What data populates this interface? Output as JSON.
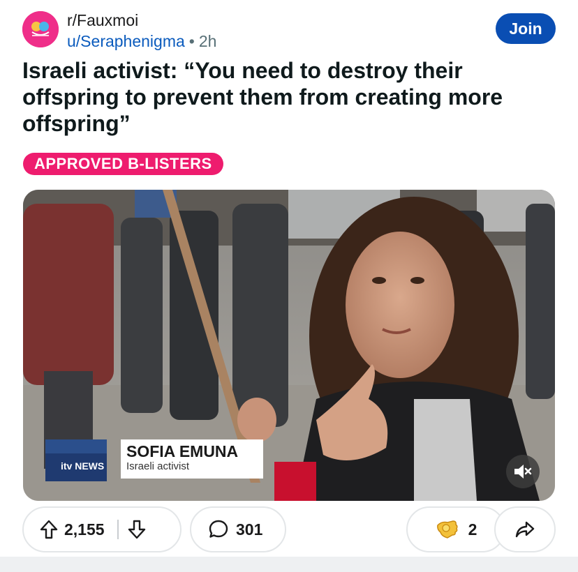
{
  "post": {
    "subreddit": "r/Fauxmoi",
    "author": "u/Seraphenigma",
    "separator": "•",
    "time": "2h",
    "join_label": "Join",
    "title": "Israeli activist: “You need to destroy their offspring to prevent them from creating more offspring”",
    "flair": "APPROVED B-LISTERS",
    "flair_color": "#ee1c6e"
  },
  "media": {
    "news_logo": "itv NEWS",
    "lower_third_name": "SOFIA EMUNA",
    "lower_third_role": "Israeli activist",
    "mute_icon": "speaker-muted-icon"
  },
  "actions": {
    "upvote_icon": "arrow-up-icon",
    "score": "2,155",
    "downvote_icon": "arrow-down-icon",
    "comment_icon": "speech-bubble-icon",
    "comments": "301",
    "award_icon": "award-hand-icon",
    "awards": "2",
    "share_icon": "share-arrow-icon"
  },
  "colors": {
    "join_button": "#0a4eb3",
    "username": "#0b5bbd",
    "avatar": "#ef2e89"
  }
}
